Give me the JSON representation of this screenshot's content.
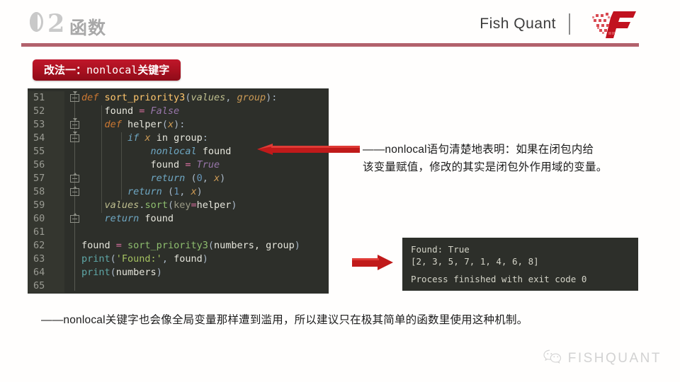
{
  "header": {
    "section_number": "02",
    "section_title": "函数",
    "brand": "Fish Quant",
    "logo_icon": "fishquant-f-logo",
    "rule_color": "#b2616c"
  },
  "tag": {
    "prefix": "改法一：",
    "keyword": "nonlocal",
    "suffix": "关键字",
    "bg_color": "#a8101f"
  },
  "code_block": {
    "background": "#2d2f2a",
    "lines": [
      {
        "num": "51",
        "fold": "down",
        "tokens": [
          {
            "t": "def ",
            "c": "kw-it"
          },
          {
            "t": "sort_priority3",
            "c": "fn"
          },
          {
            "t": "(",
            "c": "def"
          },
          {
            "t": "values",
            "c": "it-olive"
          },
          {
            "t": ", ",
            "c": "def"
          },
          {
            "t": "group",
            "c": "it-orange"
          },
          {
            "t": "):",
            "c": "def"
          }
        ]
      },
      {
        "num": "52",
        "fold": "",
        "tokens": [
          {
            "t": "    found ",
            "c": "white"
          },
          {
            "t": "= ",
            "c": "pink"
          },
          {
            "t": "False",
            "c": "it-purple"
          }
        ]
      },
      {
        "num": "53",
        "fold": "down",
        "tokens": [
          {
            "t": "    ",
            "c": "def"
          },
          {
            "t": "def ",
            "c": "kw-it"
          },
          {
            "t": "helper",
            "c": "white"
          },
          {
            "t": "(",
            "c": "def"
          },
          {
            "t": "x",
            "c": "it-orange"
          },
          {
            "t": "):",
            "c": "def"
          }
        ]
      },
      {
        "num": "54",
        "fold": "down",
        "tokens": [
          {
            "t": "        ",
            "c": "def"
          },
          {
            "t": "if ",
            "c": "it-blue"
          },
          {
            "t": "x ",
            "c": "it-orange"
          },
          {
            "t": "in ",
            "c": "white"
          },
          {
            "t": "group",
            "c": "white"
          },
          {
            "t": ":",
            "c": "def"
          }
        ]
      },
      {
        "num": "55",
        "fold": "",
        "tokens": [
          {
            "t": "            ",
            "c": "def"
          },
          {
            "t": "nonlocal ",
            "c": "it-blue"
          },
          {
            "t": "found",
            "c": "white"
          }
        ]
      },
      {
        "num": "56",
        "fold": "",
        "tokens": [
          {
            "t": "            found ",
            "c": "white"
          },
          {
            "t": "= ",
            "c": "pink"
          },
          {
            "t": "True",
            "c": "it-purple"
          }
        ]
      },
      {
        "num": "57",
        "fold": "up",
        "tokens": [
          {
            "t": "            ",
            "c": "def"
          },
          {
            "t": "return ",
            "c": "it-blue"
          },
          {
            "t": "(",
            "c": "def"
          },
          {
            "t": "0",
            "c": "num"
          },
          {
            "t": ", ",
            "c": "def"
          },
          {
            "t": "x",
            "c": "it-orange"
          },
          {
            "t": ")",
            "c": "def"
          }
        ]
      },
      {
        "num": "58",
        "fold": "up",
        "tokens": [
          {
            "t": "        ",
            "c": "def"
          },
          {
            "t": "return ",
            "c": "it-blue"
          },
          {
            "t": "(",
            "c": "def"
          },
          {
            "t": "1",
            "c": "num"
          },
          {
            "t": ", ",
            "c": "def"
          },
          {
            "t": "x",
            "c": "it-orange"
          },
          {
            "t": ")",
            "c": "def"
          }
        ]
      },
      {
        "num": "59",
        "fold": "",
        "tokens": [
          {
            "t": "    ",
            "c": "def"
          },
          {
            "t": "values",
            "c": "it-olive"
          },
          {
            "t": ".",
            "c": "def"
          },
          {
            "t": "sort",
            "c": "greenfn"
          },
          {
            "t": "(",
            "c": "def"
          },
          {
            "t": "key",
            "c": "gray"
          },
          {
            "t": "=",
            "c": "pink"
          },
          {
            "t": "helper",
            "c": "white"
          },
          {
            "t": ")",
            "c": "def"
          }
        ]
      },
      {
        "num": "60",
        "fold": "up",
        "tokens": [
          {
            "t": "    ",
            "c": "def"
          },
          {
            "t": "return ",
            "c": "it-blue"
          },
          {
            "t": "found",
            "c": "white"
          }
        ]
      },
      {
        "num": "61",
        "fold": "",
        "tokens": []
      },
      {
        "num": "62",
        "fold": "",
        "tokens": [
          {
            "t": "found ",
            "c": "white"
          },
          {
            "t": "= ",
            "c": "pink"
          },
          {
            "t": "sort_priority3",
            "c": "greenfn"
          },
          {
            "t": "(",
            "c": "def"
          },
          {
            "t": "numbers, group",
            "c": "white"
          },
          {
            "t": ")",
            "c": "def"
          }
        ]
      },
      {
        "num": "63",
        "fold": "",
        "tokens": [
          {
            "t": "print",
            "c": "teal"
          },
          {
            "t": "(",
            "c": "def"
          },
          {
            "t": "'Found:'",
            "c": "str"
          },
          {
            "t": ", ",
            "c": "def"
          },
          {
            "t": "found",
            "c": "white"
          },
          {
            "t": ")",
            "c": "def"
          }
        ]
      },
      {
        "num": "64",
        "fold": "",
        "tokens": [
          {
            "t": "print",
            "c": "teal"
          },
          {
            "t": "(",
            "c": "def"
          },
          {
            "t": "numbers",
            "c": "white"
          },
          {
            "t": ")",
            "c": "def"
          }
        ]
      },
      {
        "num": "65",
        "fold": "",
        "tokens": []
      }
    ]
  },
  "annotations": {
    "right_note_line1": "——nonlocal语句清楚地表明：如果在闭包内给",
    "right_note_line2": "该变量赋值，修改的其实是闭包外作用域的变量。",
    "bottom_note": "——nonlocal关键字也会像全局变量那样遭到滥用，所以建议只在极其简单的函数里使用这种机制。",
    "arrow_color": "#c01a1a"
  },
  "console": {
    "line1": "Found: True",
    "line2": "[2, 3, 5, 7, 1, 4, 6, 8]",
    "line3": "Process finished with exit code 0"
  },
  "footer": {
    "icon": "wechat-icon",
    "text": "FISHQUANT"
  }
}
